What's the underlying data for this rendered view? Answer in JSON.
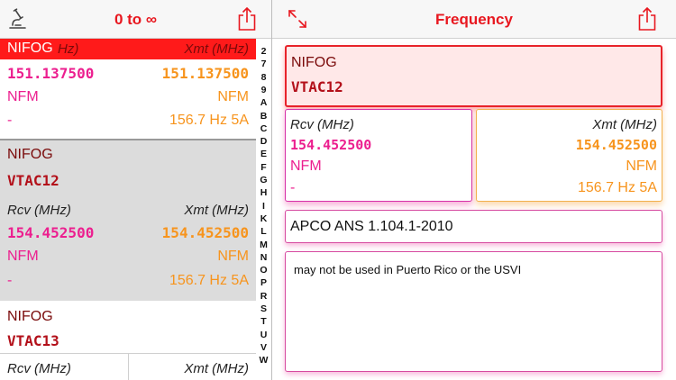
{
  "left_header": {
    "title": "0 to ∞"
  },
  "right_header": {
    "title": "Frequency"
  },
  "icons": {
    "left_tool": "microscope-icon",
    "share": "share-icon",
    "expand": "expand-arrows-icon"
  },
  "colors": {
    "accent": "#e8171f",
    "rcv": "#ec1f8f",
    "xmt": "#f7941d",
    "name": "#b3101a"
  },
  "list": {
    "rows": [
      {
        "agency": "NIFOG",
        "rcv_label_partial": "Hz)",
        "xmt_label": "Xmt (MHz)",
        "rcv_freq": "151.137500",
        "xmt_freq": "151.137500",
        "rcv_mode": "NFM",
        "xmt_mode": "NFM",
        "rcv_tone": "-",
        "xmt_tone": "156.7 Hz 5A"
      },
      {
        "agency": "NIFOG",
        "channel": "VTAC12",
        "rcv_label": "Rcv (MHz)",
        "xmt_label": "Xmt (MHz)",
        "rcv_freq": "154.452500",
        "xmt_freq": "154.452500",
        "rcv_mode": "NFM",
        "xmt_mode": "NFM",
        "rcv_tone": "-",
        "xmt_tone": "156.7 Hz 5A"
      },
      {
        "agency": "NIFOG",
        "channel": "VTAC13",
        "rcv_label": "Rcv (MHz)",
        "xmt_label": "Xmt (MHz)"
      }
    ]
  },
  "index": [
    "2",
    "7",
    "8",
    "9",
    "A",
    "B",
    "C",
    "D",
    "E",
    "F",
    "G",
    "H",
    "I",
    "K",
    "L",
    "M",
    "N",
    "O",
    "P",
    "R",
    "S",
    "T",
    "U",
    "V",
    "W"
  ],
  "detail": {
    "agency": "NIFOG",
    "channel": "VTAC12",
    "rcv_label": "Rcv (MHz)",
    "xmt_label": "Xmt (MHz)",
    "rcv_freq": "154.452500",
    "xmt_freq": "154.452500",
    "rcv_mode": "NFM",
    "xmt_mode": "NFM",
    "rcv_tone": "-",
    "xmt_tone": "156.7 Hz 5A",
    "standard": "APCO ANS 1.104.1-2010",
    "note": "may not be used in Puerto Rico or the USVI"
  }
}
